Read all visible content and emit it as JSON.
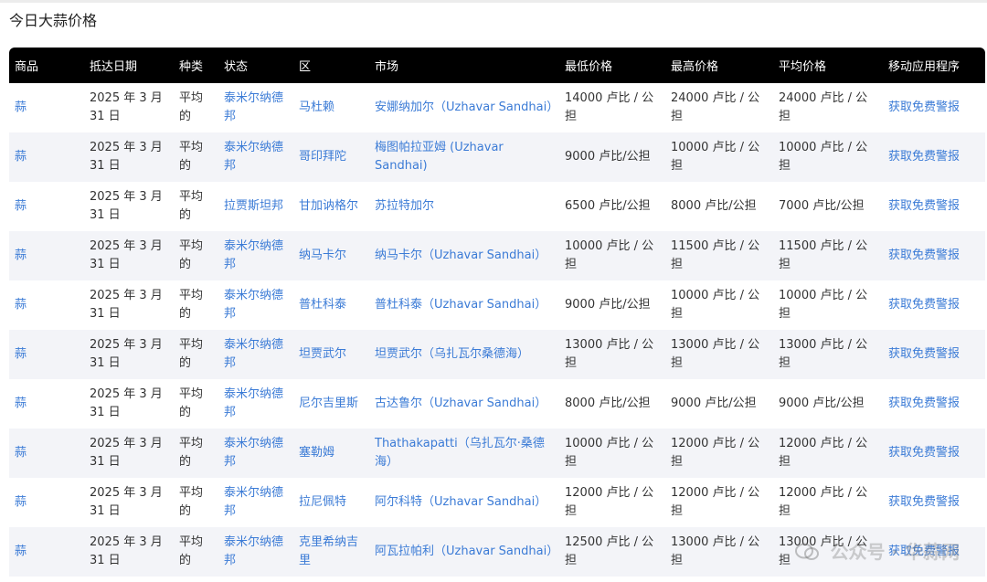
{
  "page": {
    "title": "今日大蒜价格"
  },
  "table": {
    "headers": [
      "商品",
      "抵达日期",
      "种类",
      "状态",
      "区",
      "市场",
      "最低价格",
      "最高价格",
      "平均价格",
      "移动应用程序"
    ],
    "rows": [
      [
        "蒜",
        "2025 年 3 月 31 日",
        "平均的",
        "泰米尔纳德邦",
        "马杜赖",
        "安娜纳加尔（Uzhavar Sandhai）",
        "14000 卢比 / 公担",
        "24000 卢比 / 公担",
        "24000 卢比 / 公担",
        "获取免费警报"
      ],
      [
        "蒜",
        "2025 年 3 月 31 日",
        "平均的",
        "泰米尔纳德邦",
        "哥印拜陀",
        "梅图帕拉亚姆 (Uzhavar Sandhai)",
        "9000 卢比/公担",
        "10000 卢比 / 公担",
        "10000 卢比 / 公担",
        "获取免费警报"
      ],
      [
        "蒜",
        "2025 年 3 月 31 日",
        "平均的",
        "拉贾斯坦邦",
        "甘加讷格尔",
        "苏拉特加尔",
        "6500 卢比/公担",
        "8000 卢比/公担",
        "7000 卢比/公担",
        "获取免费警报"
      ],
      [
        "蒜",
        "2025 年 3 月 31 日",
        "平均的",
        "泰米尔纳德邦",
        "纳马卡尔",
        "纳马卡尔（Uzhavar Sandhai）",
        "10000 卢比 / 公担",
        "11500 卢比 / 公担",
        "11500 卢比 / 公担",
        "获取免费警报"
      ],
      [
        "蒜",
        "2025 年 3 月 31 日",
        "平均的",
        "泰米尔纳德邦",
        "普杜科泰",
        "普杜科泰（Uzhavar Sandhai）",
        "9000 卢比/公担",
        "10000 卢比 / 公担",
        "10000 卢比 / 公担",
        "获取免费警报"
      ],
      [
        "蒜",
        "2025 年 3 月 31 日",
        "平均的",
        "泰米尔纳德邦",
        "坦贾武尔",
        "坦贾武尔（乌扎瓦尔桑德海）",
        "13000 卢比 / 公担",
        "13000 卢比 / 公担",
        "13000 卢比 / 公担",
        "获取免费警报"
      ],
      [
        "蒜",
        "2025 年 3 月 31 日",
        "平均的",
        "泰米尔纳德邦",
        "尼尔吉里斯",
        "古达鲁尔（Uzhavar Sandhai）",
        "8000 卢比/公担",
        "9000 卢比/公担",
        "9000 卢比/公担",
        "获取免费警报"
      ],
      [
        "蒜",
        "2025 年 3 月 31 日",
        "平均的",
        "泰米尔纳德邦",
        "塞勒姆",
        "Thathakapatti（乌扎瓦尔·桑德海）",
        "10000 卢比 / 公担",
        "12000 卢比 / 公担",
        "12000 卢比 / 公担",
        "获取免费警报"
      ],
      [
        "蒜",
        "2025 年 3 月 31 日",
        "平均的",
        "泰米尔纳德邦",
        "拉尼佩特",
        "阿尔科特（Uzhavar Sandhai）",
        "12000 卢比 / 公担",
        "12000 卢比 / 公担",
        "12000 卢比 / 公担",
        "获取免费警报"
      ],
      [
        "蒜",
        "2025 年 3 月 31 日",
        "平均的",
        "泰米尔纳德邦",
        "克里希纳吉里",
        "阿瓦拉帕利（Uzhavar Sandhai）",
        "12500 卢比 / 公担",
        "13000 卢比 / 公担",
        "13000 卢比 / 公担",
        "获取免费警报"
      ]
    ]
  },
  "watermark": {
    "text": "公众号 · 华蒜网"
  },
  "colors": {
    "link": "#3b7bd6",
    "header_bg": "#000000",
    "stripe": "#f3f4f8"
  }
}
